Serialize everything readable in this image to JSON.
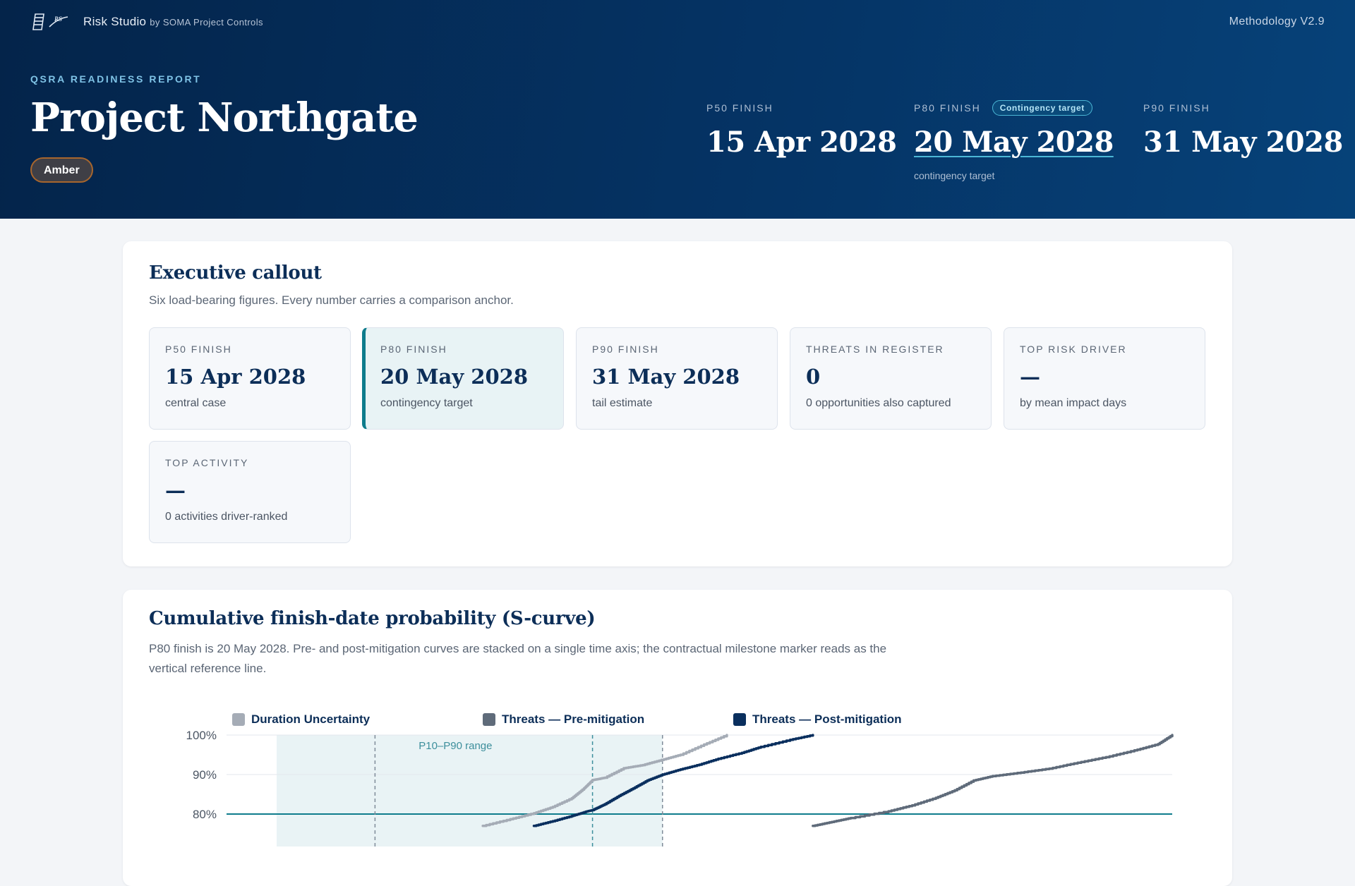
{
  "brand": {
    "name": "Risk Studio",
    "by": "by SOMA Project Controls",
    "logo_text": "RS"
  },
  "methodology": "Methodology V2.9",
  "report": {
    "eyebrow": "QSRA READINESS REPORT",
    "project": "Project Northgate",
    "rag": "Amber"
  },
  "header_stats": [
    {
      "label": "P50 FINISH",
      "value": "15 Apr 2028",
      "sub": ""
    },
    {
      "label": "P80 FINISH",
      "value": "20 May 2028",
      "badge": "Contingency target",
      "sub": "contingency target"
    },
    {
      "label": "P90 FINISH",
      "value": "31 May 2028",
      "sub": ""
    }
  ],
  "executive": {
    "title": "Executive callout",
    "subtitle": "Six load-bearing figures. Every number carries a comparison anchor.",
    "kpis": [
      {
        "label": "P50 FINISH",
        "value": "15 Apr 2028",
        "sub": "central case"
      },
      {
        "label": "P80 FINISH",
        "value": "20 May 2028",
        "sub": "contingency target"
      },
      {
        "label": "P90 FINISH",
        "value": "31 May 2028",
        "sub": "tail estimate"
      },
      {
        "label": "THREATS IN REGISTER",
        "value": "0",
        "sub": "0 opportunities also captured"
      },
      {
        "label": "TOP RISK DRIVER",
        "value": "—",
        "sub": "by mean impact days"
      },
      {
        "label": "TOP ACTIVITY",
        "value": "—",
        "sub": "0 activities driver-ranked"
      }
    ]
  },
  "scurve": {
    "title": "Cumulative finish-date probability (S-curve)",
    "subtitle_line1": "P80 finish is 20 May 2028. Pre- and post-mitigation curves are stacked on a single time axis; the contractual milestone marker reads as the",
    "subtitle_line2": "vertical reference line."
  },
  "colors": {
    "accent": "#0e7c8c",
    "navy": "#0c2e58",
    "amber": "#a8662d"
  },
  "chart_data": {
    "type": "line",
    "ylabel": "",
    "xlabel": "",
    "y_ticks": [
      100,
      90,
      80
    ],
    "y_tick_labels": [
      "100%",
      "90%",
      "80%"
    ],
    "ylim_visible": [
      77,
      100
    ],
    "x_visible": [
      0,
      100
    ],
    "band": {
      "label": "P10–P90 range",
      "x_from": 5.3,
      "x_to": 46.1
    },
    "markers_x": [
      15.7,
      38.7,
      46.1
    ],
    "reference_y": 80,
    "series": [
      {
        "name": "Duration Uncertainty",
        "color": "#a5acb6",
        "x": [
          27.1,
          30,
          32.5,
          34.5,
          36.5,
          37.8,
          38.7,
          40,
          42,
          44,
          46,
          48,
          50.5,
          52.9
        ],
        "y": [
          77,
          78.7,
          80.2,
          81.8,
          84,
          86.5,
          88.6,
          89.2,
          91.6,
          92.4,
          93.7,
          95,
          97.6,
          100
        ]
      },
      {
        "name": "Threats — Pre-mitigation",
        "color": "#5f6b7a",
        "x": [
          62,
          64,
          66,
          70,
          72.5,
          75,
          77,
          79,
          81,
          84,
          87,
          90,
          93,
          96,
          98.5,
          100
        ],
        "y": [
          77,
          78,
          79,
          80.7,
          82.2,
          84.1,
          86,
          88.5,
          89.6,
          90.5,
          91.5,
          93,
          94.4,
          96.1,
          97.7,
          100
        ]
      },
      {
        "name": "Threats — Post-mitigation",
        "color": "#0a2f5e",
        "x": [
          32.5,
          34.5,
          36.5,
          38,
          38.7,
          40,
          41.5,
          43,
          44.5,
          46.1,
          48,
          50,
          52,
          54.5,
          56.5,
          59.6,
          62
        ],
        "y": [
          77,
          78.2,
          79.5,
          80.6,
          81,
          82.5,
          84.6,
          86.5,
          88.5,
          90,
          91.3,
          92.5,
          94,
          95.5,
          97,
          98.8,
          100
        ]
      }
    ]
  }
}
